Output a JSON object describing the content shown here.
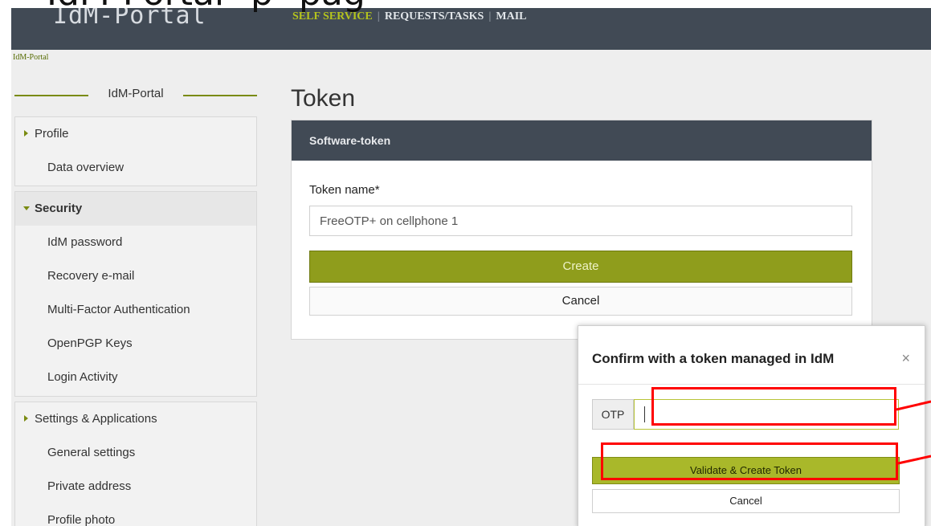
{
  "caption": {
    "part1": "IdM-Portal",
    "part2": "p",
    "part3": "pag"
  },
  "header": {
    "brand": "IdM-Portal",
    "nav": [
      {
        "label": "SELF SERVICE",
        "active": true
      },
      {
        "label": "REQUESTS/TASKS",
        "active": false
      },
      {
        "label": "MAIL",
        "active": false
      }
    ],
    "separator": "|"
  },
  "breadcrumb": {
    "label": "IdM-Portal"
  },
  "sidebar": {
    "title": "IdM-Portal",
    "sections": [
      {
        "label": "Profile",
        "expanded": false,
        "items": [
          "Data overview"
        ]
      },
      {
        "label": "Security",
        "expanded": true,
        "items": [
          "IdM password",
          "Recovery e-mail",
          "Multi-Factor Authentication",
          "OpenPGP Keys",
          "Login Activity"
        ]
      },
      {
        "label": "Settings & Applications",
        "expanded": false,
        "items": [
          "General settings",
          "Private address",
          "Profile photo"
        ]
      }
    ]
  },
  "main": {
    "title": "Token",
    "card_title": "Software-token",
    "token_label": "Token name*",
    "token_value": "FreeOTP+ on cellphone 1",
    "create_label": "Create",
    "cancel_label": "Cancel"
  },
  "modal": {
    "title": "Confirm with a token managed in IdM",
    "close": "×",
    "otp_addon": "OTP",
    "otp_value": "",
    "validate_label": "Validate & Create Token",
    "cancel_label": "Cancel"
  },
  "colors": {
    "accent": "#8f9d1c",
    "header_bg": "#414a55",
    "highlight": "#ff0000"
  }
}
